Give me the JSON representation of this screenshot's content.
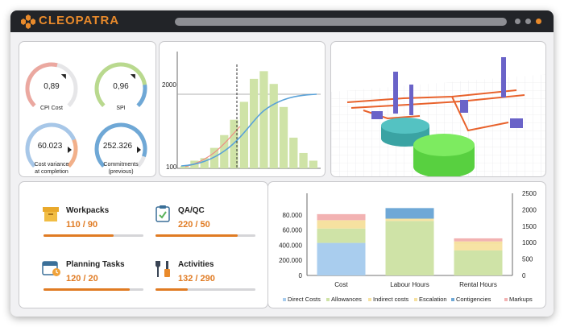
{
  "app": {
    "brand": "CLEOPATRA"
  },
  "colors": {
    "accent": "#e07b23",
    "titlebar": "#222428",
    "dot1": "#8d8e93",
    "dot2": "#8d8e93",
    "dot3": "#e98a2b"
  },
  "gauges": [
    {
      "value": "0,89",
      "label": "CPI Cost",
      "color": "#eba8a0",
      "fill": 0.55,
      "pointer": "marker"
    },
    {
      "value": "0,96",
      "label": "SPI",
      "color": "#b9d98e",
      "accent": "#6fa8d6",
      "fill": 0.8,
      "pointer": "marker"
    },
    {
      "value": "60.023",
      "label_line1": "Cost variance",
      "label_line2": "at completion",
      "color": "#a7c7e8",
      "accent": "#f2b08a",
      "fill": 0.75,
      "pointer": "arrow"
    },
    {
      "value": "252.326",
      "label_line1": "Commitments",
      "label_line2": "(previous)",
      "color": "#6fa8d6",
      "fill": 0.9,
      "pointer": "arrow"
    }
  ],
  "distribution": {
    "y_ticks": [
      "2000",
      "100"
    ],
    "bars": [
      2,
      6,
      8,
      16,
      26,
      38,
      52,
      70,
      76,
      66,
      48,
      24,
      12,
      6
    ]
  },
  "kpis": [
    {
      "icon": "workpacks-box-icon",
      "title": "Workpacks",
      "value": "110 / 90",
      "fill": 0.7
    },
    {
      "icon": "qaqc-clipboard-icon",
      "title": "QA/QC",
      "value": "220 / 50",
      "fill": 0.82
    },
    {
      "icon": "calendar-clock-icon",
      "title": "Planning Tasks",
      "value": "120 / 20",
      "fill": 0.86
    },
    {
      "icon": "wrench-screwdriver-icon",
      "title": "Activities",
      "value": "132 / 290",
      "fill": 0.32
    }
  ],
  "chart_data": {
    "type": "bar",
    "stacked": true,
    "categories": [
      "Cost",
      "Labour Hours",
      "Rental Hours"
    ],
    "left_axis_ticks": [
      "80.000",
      "60.000",
      "400.000",
      "200.000",
      "0"
    ],
    "right_axis_ticks": [
      "2500",
      "2000",
      "1500",
      "1000",
      "500",
      "0"
    ],
    "ylim_left": [
      0,
      100000
    ],
    "ylim_right": [
      0,
      2500
    ],
    "series": [
      {
        "name": "Direct Costs",
        "color": "#a9cdee",
        "values": [
          43000,
          0,
          0
        ]
      },
      {
        "name": "Allowances",
        "color": "#cfe3a7",
        "values": [
          19000,
          72000,
          33000
        ]
      },
      {
        "name": "Indirect costs",
        "color": "#f7e3a4",
        "values": [
          0,
          3000,
          8000
        ]
      },
      {
        "name": "Escalation",
        "color": "#f6e1a0",
        "values": [
          11000,
          0,
          4000
        ]
      },
      {
        "name": "Contigencies",
        "color": "#6fa8d6",
        "values": [
          0,
          14000,
          0
        ]
      },
      {
        "name": "Markups",
        "color": "#f2b2b2",
        "values": [
          8000,
          0,
          4000
        ]
      }
    ],
    "legend_position": "bottom",
    "grid": false
  }
}
